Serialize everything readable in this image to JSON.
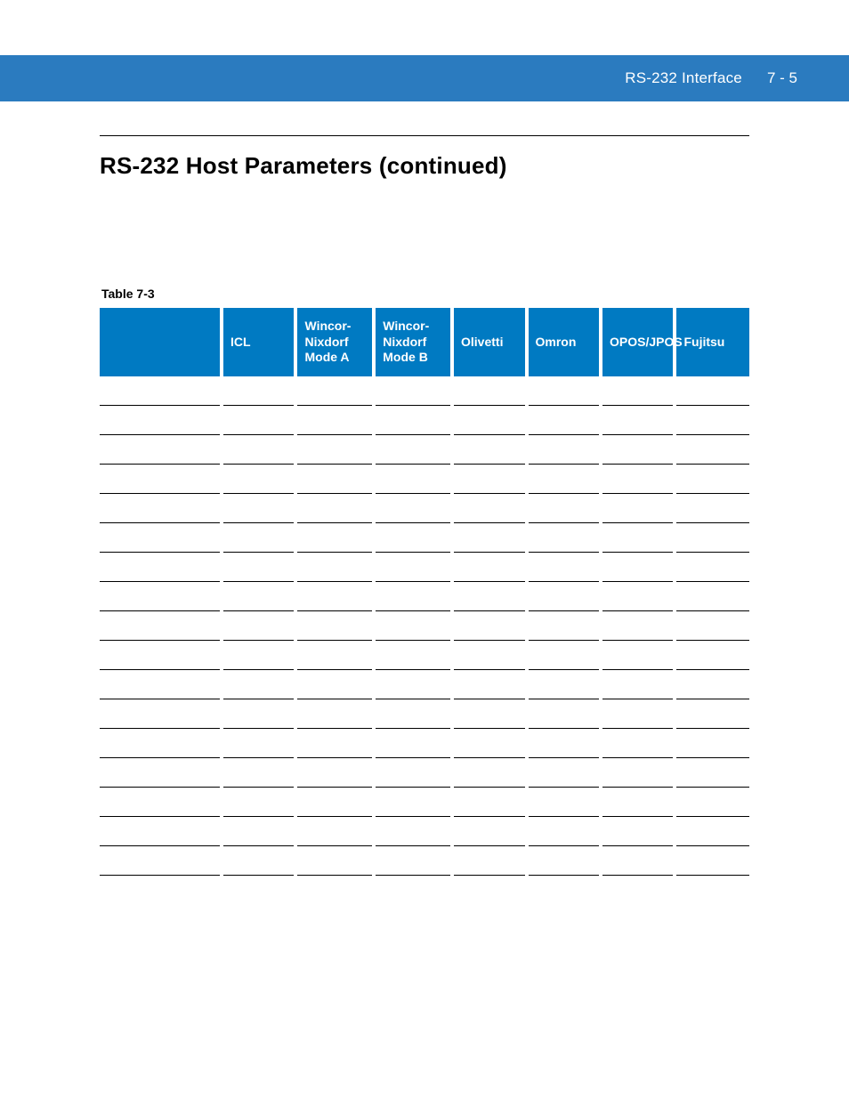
{
  "header": {
    "section": "RS-232 Interface",
    "page_number": "7 - 5"
  },
  "heading": "RS-232 Host Parameters (continued)",
  "table_label": "Table 7-3",
  "table": {
    "columns": [
      "",
      "ICL",
      "Wincor-Nixdorf Mode A",
      "Wincor-Nixdorf Mode B",
      "Olivetti",
      "Omron",
      "OPOS/JPOS",
      "Fujitsu"
    ],
    "rows": [
      [
        "",
        "",
        "",
        "",
        "",
        "",
        "",
        ""
      ],
      [
        "",
        "",
        "",
        "",
        "",
        "",
        "",
        ""
      ],
      [
        "",
        "",
        "",
        "",
        "",
        "",
        "",
        ""
      ],
      [
        "",
        "",
        "",
        "",
        "",
        "",
        "",
        ""
      ],
      [
        "",
        "",
        "",
        "",
        "",
        "",
        "",
        ""
      ],
      [
        "",
        "",
        "",
        "",
        "",
        "",
        "",
        ""
      ],
      [
        "",
        "",
        "",
        "",
        "",
        "",
        "",
        ""
      ],
      [
        "",
        "",
        "",
        "",
        "",
        "",
        "",
        ""
      ],
      [
        "",
        "",
        "",
        "",
        "",
        "",
        "",
        ""
      ],
      [
        "",
        "",
        "",
        "",
        "",
        "",
        "",
        ""
      ],
      [
        "",
        "",
        "",
        "",
        "",
        "",
        "",
        ""
      ],
      [
        "",
        "",
        "",
        "",
        "",
        "",
        "",
        ""
      ],
      [
        "",
        "",
        "",
        "",
        "",
        "",
        "",
        ""
      ],
      [
        "",
        "",
        "",
        "",
        "",
        "",
        "",
        ""
      ],
      [
        "",
        "",
        "",
        "",
        "",
        "",
        "",
        ""
      ],
      [
        "",
        "",
        "",
        "",
        "",
        "",
        "",
        ""
      ],
      [
        "",
        "",
        "",
        "",
        "",
        "",
        "",
        ""
      ]
    ]
  }
}
